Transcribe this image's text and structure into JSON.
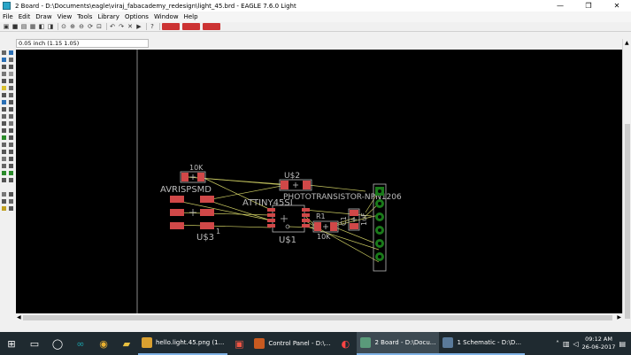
{
  "window": {
    "title": "2 Board - D:\\Documents\\eagle\\viraj_fabacademy_redesign\\light_45.brd - EAGLE 7.6.0 Light",
    "minimize": "—",
    "maximize": "❐",
    "close": "✕"
  },
  "menu": [
    "File",
    "Edit",
    "Draw",
    "View",
    "Tools",
    "Library",
    "Options",
    "Window",
    "Help"
  ],
  "coord_display": "0.05 inch (1.15 1.05)",
  "board": {
    "labels": {
      "r_top": "10K",
      "usb2": "U$2",
      "avrisp": "AVRISPSMD",
      "phototransistor": "PHOTOTRANSISTOR-NPN1206",
      "attiny": "ATTINY45SI",
      "r1": "R1",
      "c1": "C1",
      "c1_val": "1uF",
      "u3": "U$3",
      "u3_pin": "1",
      "u1": "U$1",
      "r1_val": "10K"
    }
  },
  "taskbar": {
    "tasks": [
      {
        "label": "hello.light.45.png (1...",
        "state": "open"
      },
      {
        "label": "Control Panel - D:\\...",
        "state": "normal"
      },
      {
        "label": "2 Board - D:\\Docu...",
        "state": "active"
      },
      {
        "label": "1 Schematic - D:\\D...",
        "state": "open"
      }
    ],
    "time": "09:12 AM",
    "date": "26-06-2017",
    "lang": "ENG"
  },
  "colors": {
    "canvas": "#000000",
    "pad_red": "#d04848",
    "airwire": "#c8c860",
    "outline": "#bbbbbb",
    "header_green": "#1a7a1a"
  }
}
